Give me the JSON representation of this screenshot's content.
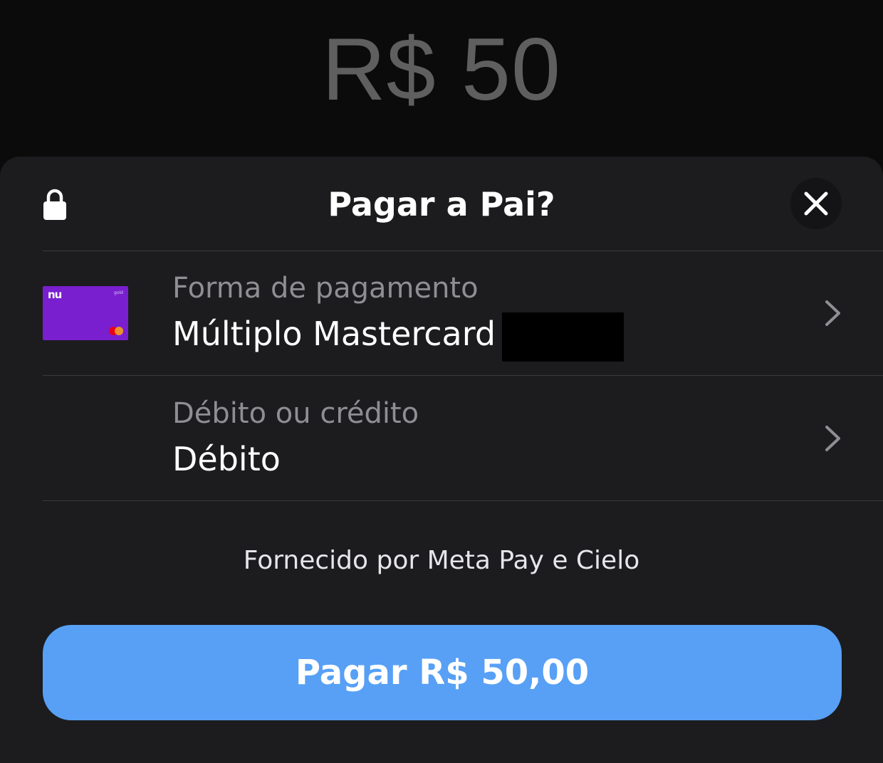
{
  "background": {
    "amount": "R$ 50"
  },
  "sheet": {
    "title": "Pagar a Pai?",
    "lock_icon": "lock-icon",
    "close_icon": "close-icon"
  },
  "payment_method": {
    "label": "Forma de pagamento",
    "value": "Múltiplo Mastercard",
    "card_logo": "nu",
    "card_tier": "gold",
    "card_color": "#7a1fd0",
    "chevron_icon": "chevron-right-icon"
  },
  "debit_credit": {
    "label": "Débito ou crédito",
    "value": "Débito",
    "chevron_icon": "chevron-right-icon"
  },
  "footer": {
    "provider_note": "Fornecido por Meta Pay e Cielo"
  },
  "pay_button": {
    "label": "Pagar R$ 50,00",
    "color": "#57a0f5"
  }
}
